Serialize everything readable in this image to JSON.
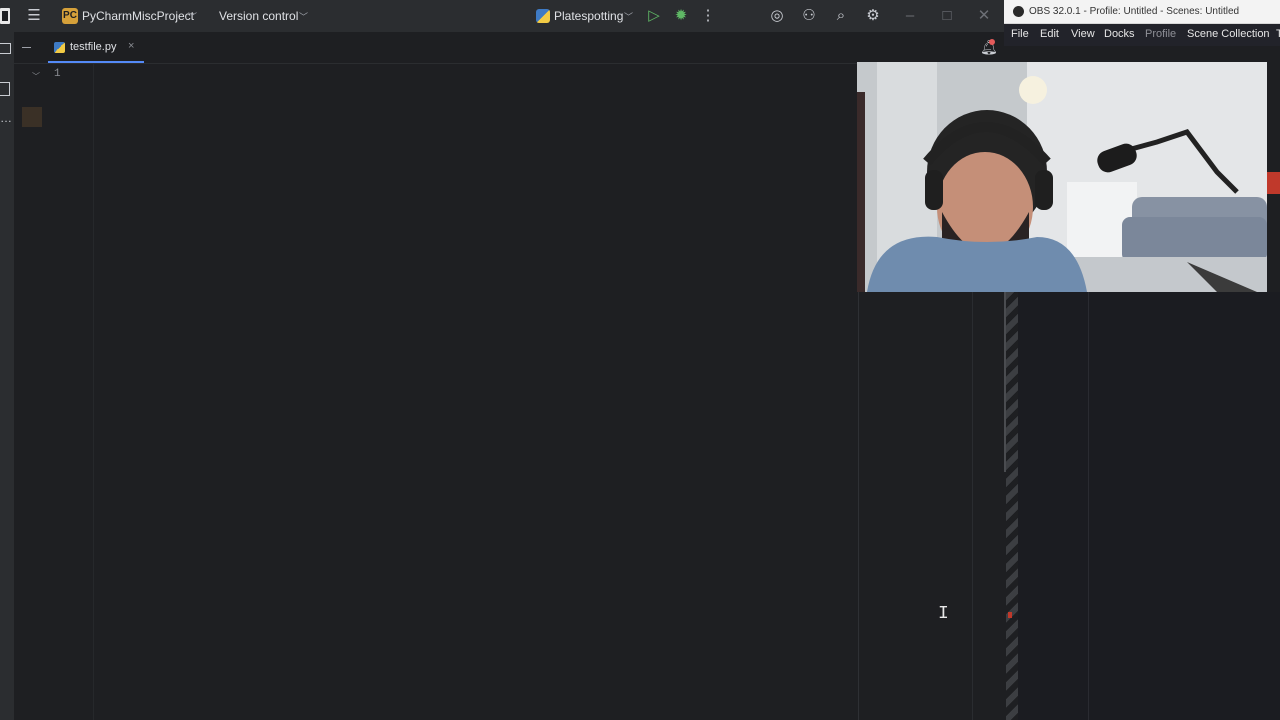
{
  "pycharm": {
    "project_badge": "PC",
    "project_name": "PyCharmMiscProject",
    "vcs_label": "Version control",
    "run_config": "Platespotting",
    "tab_label": "testfile.py",
    "line_numbers": [
      "1"
    ],
    "icons": {
      "menu": "hamburger-menu-icon",
      "run": "run-icon",
      "debug": "debug-icon",
      "more": "more-vertical-icon",
      "ai": "ai-assistant-icon",
      "add_user": "add-user-icon",
      "search": "search-icon",
      "settings": "gear-icon",
      "notifications": "bell-icon"
    }
  },
  "obs": {
    "title": "OBS 32.0.1 - Profile: Untitled - Scenes: Untitled",
    "menu": [
      "File",
      "Edit",
      "View",
      "Docks",
      "Profile",
      "Scene Collection",
      "T"
    ]
  },
  "colors": {
    "accent": "#548af7",
    "run_green": "#5fb865",
    "badge_orange": "#d6a13a",
    "notify_red": "#e55b5b"
  }
}
